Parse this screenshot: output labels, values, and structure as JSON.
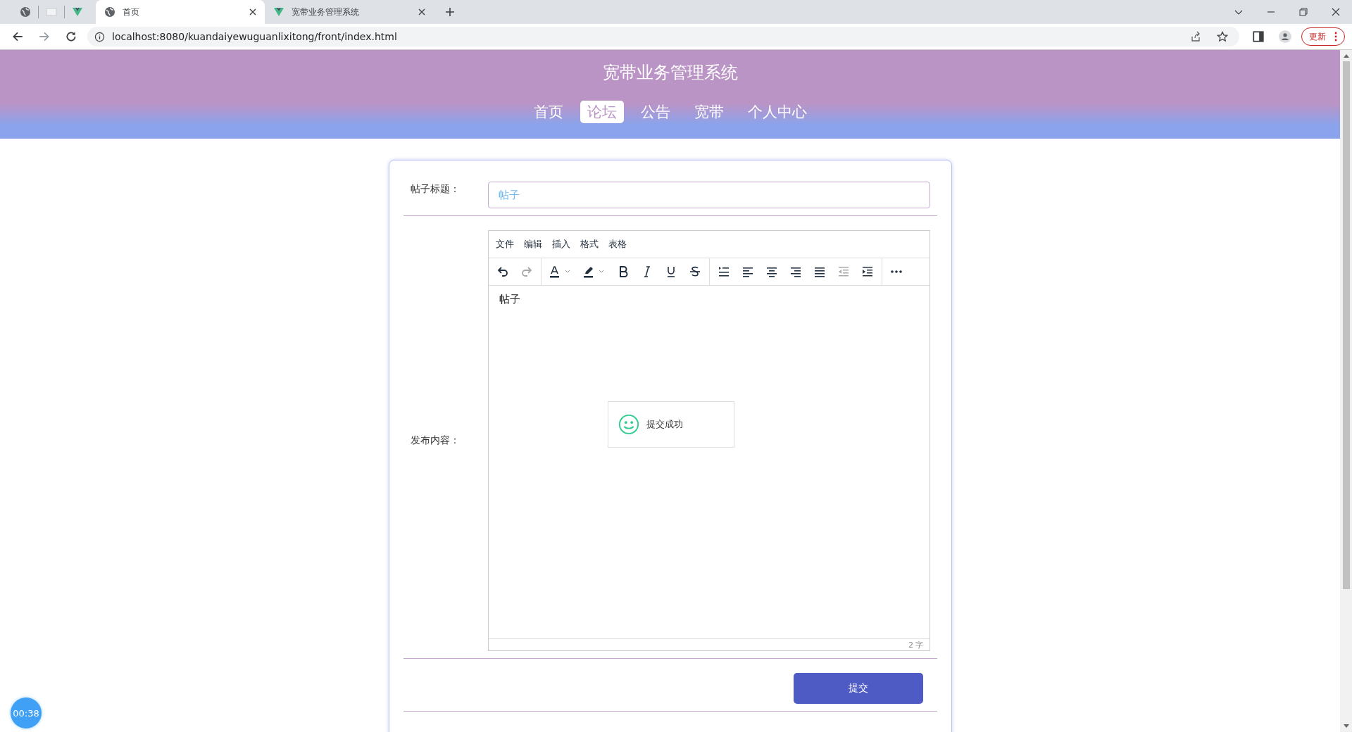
{
  "browser": {
    "tabs": [
      {
        "title": "首页",
        "selected": true
      },
      {
        "title": "宽带业务管理系统",
        "selected": false
      }
    ],
    "address": "localhost:8080/kuandaiyewuguanlixitong/front/index.html",
    "update_button": "更新"
  },
  "header": {
    "title": "宽带业务管理系统",
    "nav": [
      {
        "label": "首页",
        "selected": false
      },
      {
        "label": "论坛",
        "selected": true
      },
      {
        "label": "公告",
        "selected": false
      },
      {
        "label": "宽带",
        "selected": false
      },
      {
        "label": "个人中心",
        "selected": false
      }
    ]
  },
  "form": {
    "title_label": "帖子标题：",
    "title_value": "帖子",
    "content_label": "发布内容：",
    "editor": {
      "menu": [
        "文件",
        "编辑",
        "插入",
        "格式",
        "表格"
      ],
      "toolbar": [
        [
          {
            "kind": "undo",
            "disabled": false
          },
          {
            "kind": "redo",
            "disabled": true
          }
        ],
        [
          {
            "kind": "font-color",
            "disabled": false
          },
          {
            "kind": "highlight",
            "disabled": false
          },
          {
            "kind": "bold",
            "disabled": false
          },
          {
            "kind": "italic",
            "disabled": false
          },
          {
            "kind": "underline",
            "disabled": false
          },
          {
            "kind": "strike",
            "disabled": false
          }
        ],
        [
          {
            "kind": "line-height",
            "disabled": false
          },
          {
            "kind": "align-left",
            "disabled": false
          },
          {
            "kind": "align-center",
            "disabled": false
          },
          {
            "kind": "align-right",
            "disabled": false
          },
          {
            "kind": "justify",
            "disabled": false
          },
          {
            "kind": "outdent",
            "disabled": true
          },
          {
            "kind": "indent",
            "disabled": false
          }
        ],
        [
          {
            "kind": "more",
            "disabled": false
          }
        ]
      ],
      "content": "帖子",
      "word_count": "2 字"
    },
    "submit": "提交"
  },
  "toast": {
    "message": "提交成功"
  },
  "timer": "00:38"
}
